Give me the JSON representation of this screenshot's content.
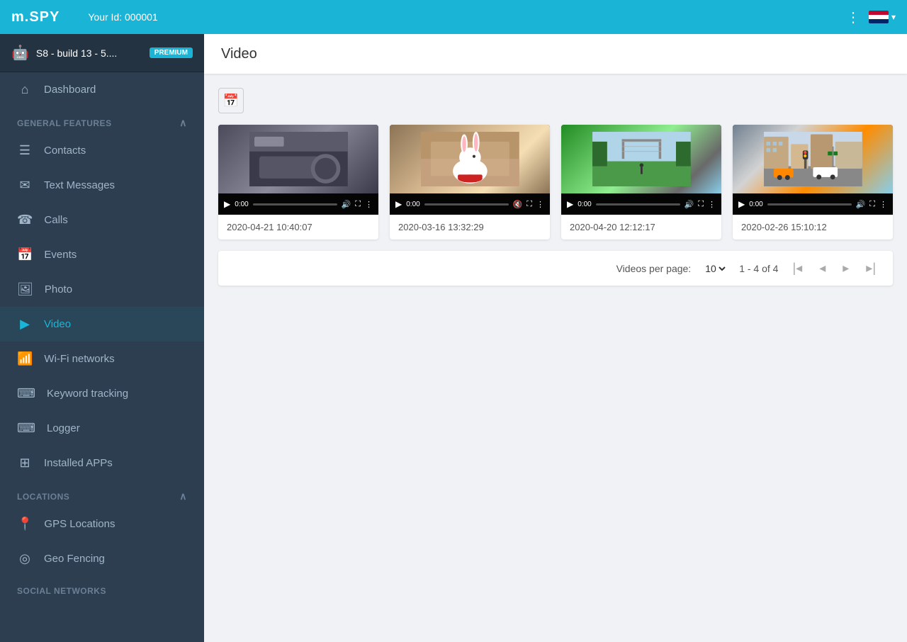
{
  "app": {
    "logo": "m.SPY",
    "user_id_label": "Your Id: 000001"
  },
  "header": {
    "page_title": "Video",
    "three_dots": "⋮",
    "flag_alt": "US Flag",
    "chevron": "▾"
  },
  "sidebar": {
    "device": {
      "name": "S8 - build 13 - 5....",
      "badge": "PREMIUM"
    },
    "nav_items": [
      {
        "id": "dashboard",
        "label": "Dashboard",
        "icon": "⌂"
      },
      {
        "id": "contacts",
        "label": "Contacts",
        "icon": "☰"
      },
      {
        "id": "text-messages",
        "label": "Text Messages",
        "icon": "✉"
      },
      {
        "id": "calls",
        "label": "Calls",
        "icon": "☎"
      },
      {
        "id": "events",
        "label": "Events",
        "icon": "📅"
      },
      {
        "id": "photo",
        "label": "Photo",
        "icon": "🖼"
      },
      {
        "id": "video",
        "label": "Video",
        "icon": "▶",
        "active": true
      }
    ],
    "general_section": "GENERAL FEATURES",
    "more_items": [
      {
        "id": "wifi",
        "label": "Wi-Fi networks",
        "icon": "📶"
      },
      {
        "id": "keyword",
        "label": "Keyword tracking",
        "icon": "⌨"
      },
      {
        "id": "logger",
        "label": "Logger",
        "icon": "⌨"
      },
      {
        "id": "apps",
        "label": "Installed APPs",
        "icon": "⊞"
      }
    ],
    "locations_section": "LOCATIONS",
    "location_items": [
      {
        "id": "gps",
        "label": "GPS Locations",
        "icon": "📍"
      },
      {
        "id": "geofencing",
        "label": "Geo Fencing",
        "icon": "◎"
      }
    ],
    "social_section": "SOCIAL NETWORKS"
  },
  "videos": [
    {
      "id": 1,
      "timestamp": "2020-04-21 10:40:07",
      "thumb_class": "thumb-1",
      "thumb_emoji": "🚗",
      "duration": "0:00"
    },
    {
      "id": 2,
      "timestamp": "2020-03-16 13:32:29",
      "thumb_class": "thumb-2",
      "thumb_emoji": "🐇",
      "duration": "0:00"
    },
    {
      "id": 3,
      "timestamp": "2020-04-20 12:12:17",
      "thumb_class": "thumb-3",
      "thumb_emoji": "⚽",
      "duration": "0:00"
    },
    {
      "id": 4,
      "timestamp": "2020-02-26 15:10:12",
      "thumb_class": "thumb-4",
      "thumb_emoji": "🏙",
      "duration": "0:00"
    }
  ],
  "pagination": {
    "per_page_label": "Videos per page:",
    "per_page_value": "10",
    "range": "1 - 4 of 4"
  }
}
